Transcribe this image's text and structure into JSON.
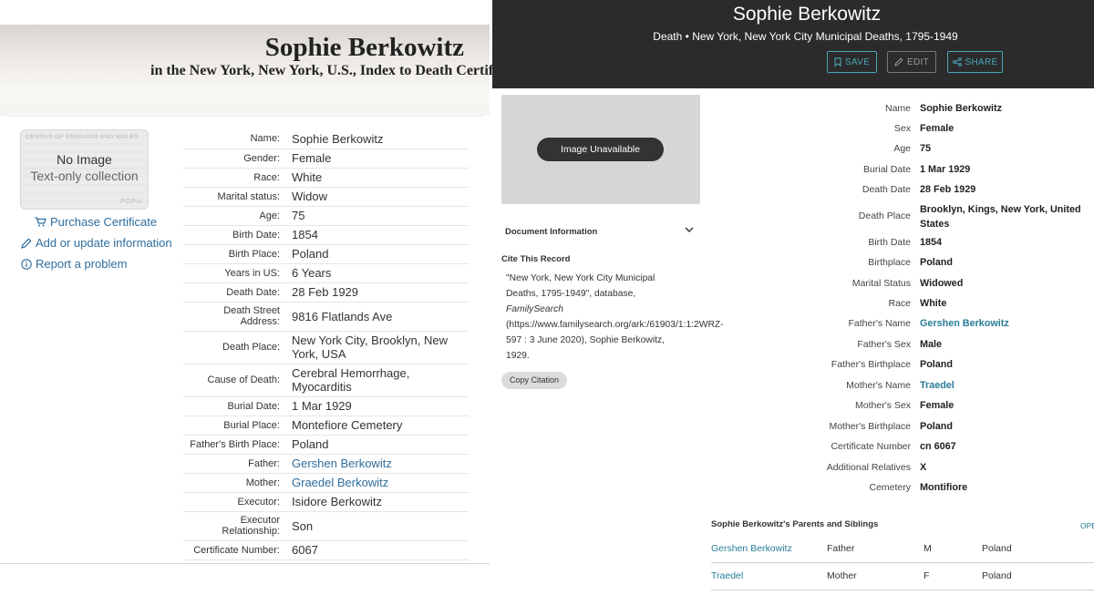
{
  "left": {
    "title": "Sophie Berkowitz",
    "subtitle": "in the New York, New York, U.S., Index to Death Certifi",
    "thumb": {
      "ghost_top": "CENSUS OF ENGLAND AND WALES",
      "line1": "No Image",
      "line2": "Text-only collection",
      "ghost_bottom": "POPU"
    },
    "actions": {
      "purchase": "Purchase Certificate",
      "add": "Add or update information",
      "report": "Report a problem"
    },
    "fields": [
      {
        "label": "Name:",
        "value": "Sophie Berkowitz"
      },
      {
        "label": "Gender:",
        "value": "Female"
      },
      {
        "label": "Race:",
        "value": "White"
      },
      {
        "label": "Marital status:",
        "value": "Widow"
      },
      {
        "label": "Age:",
        "value": "75"
      },
      {
        "label": "Birth Date:",
        "value": "1854"
      },
      {
        "label": "Birth Place:",
        "value": "Poland"
      },
      {
        "label": "Years in US:",
        "value": "6 Years"
      },
      {
        "label": "Death Date:",
        "value": "28 Feb 1929"
      },
      {
        "label": "Death Street Address:",
        "value": "9816 Flatlands Ave"
      },
      {
        "label": "Death Place:",
        "value": "New York City, Brooklyn, New York, USA"
      },
      {
        "label": "Cause of Death:",
        "value": "Cerebral Hemorrhage, Myocarditis"
      },
      {
        "label": "Burial Date:",
        "value": "1 Mar 1929"
      },
      {
        "label": "Burial Place:",
        "value": "Montefiore Cemetery"
      },
      {
        "label": "Father's Birth Place:",
        "value": "Poland"
      },
      {
        "label": "Father:",
        "value": "Gershen Berkowitz",
        "link": true
      },
      {
        "label": "Mother:",
        "value": "Graedel Berkowitz",
        "link": true
      },
      {
        "label": "Executor:",
        "value": "Isidore Berkowitz"
      },
      {
        "label": "Executor Relationship:",
        "value": "Son"
      },
      {
        "label": "Certificate Number:",
        "value": "6067"
      }
    ]
  },
  "right": {
    "name": "Sophie Berkowitz",
    "collection": "Death • New York, New York City Municipal Deaths, 1795-1949",
    "buttons": {
      "save": "SAVE",
      "edit": "EDIT",
      "share": "SHARE"
    },
    "image_unavailable": "Image Unavailable",
    "doc_info": "Document Information",
    "cite_heading": "Cite This Record",
    "citation": {
      "part1": "\"New York, New York City Municipal Deaths, 1795-1949\", database, ",
      "italic": "FamilySearch",
      "part2": " (https://www.familysearch.org/ark:/61903/1:1:2WRZ-597 : 3 June 2020), Sophie Berkowitz, 1929."
    },
    "copy_citation": "Copy Citation",
    "fields": [
      {
        "label": "Name",
        "value": "Sophie Berkowitz"
      },
      {
        "label": "Sex",
        "value": "Female"
      },
      {
        "label": "Age",
        "value": "75"
      },
      {
        "label": "Burial Date",
        "value": "1 Mar 1929"
      },
      {
        "label": "Death Date",
        "value": "28 Feb 1929"
      },
      {
        "label": "Death Place",
        "value": "Brooklyn, Kings, New York, United States"
      },
      {
        "label": "Birth Date",
        "value": "1854"
      },
      {
        "label": "Birthplace",
        "value": "Poland"
      },
      {
        "label": "Marital Status",
        "value": "Widowed"
      },
      {
        "label": "Race",
        "value": "White"
      },
      {
        "label": "Father's Name",
        "value": "Gershen Berkowitz",
        "link": true
      },
      {
        "label": "Father's Sex",
        "value": "Male"
      },
      {
        "label": "Father's Birthplace",
        "value": "Poland"
      },
      {
        "label": "Mother's Name",
        "value": "Traedel",
        "link": true
      },
      {
        "label": "Mother's Sex",
        "value": "Female"
      },
      {
        "label": "Mother's Birthplace",
        "value": "Poland"
      },
      {
        "label": "Certificate Number",
        "value": "cn 6067"
      },
      {
        "label": "Additional Relatives",
        "value": "X"
      },
      {
        "label": "Cemetery",
        "value": "Montifiore"
      }
    ],
    "parents_heading": "Sophie Berkowitz's Parents and Siblings",
    "parents_open": "OPE",
    "parents": [
      {
        "name": "Gershen Berkowitz",
        "relation": "Father",
        "sex": "M",
        "birthplace": "Poland"
      },
      {
        "name": "Traedel",
        "relation": "Mother",
        "sex": "F",
        "birthplace": "Poland"
      }
    ]
  }
}
